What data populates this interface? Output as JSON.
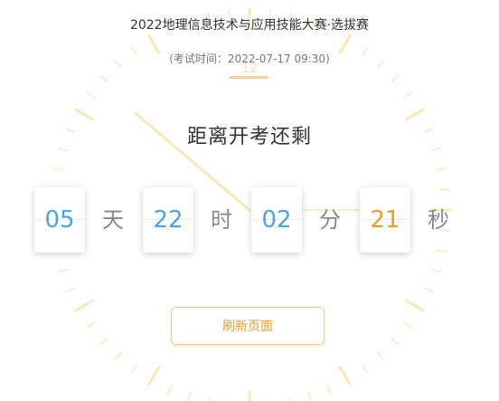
{
  "header": {
    "title": "2022地理信息技术与应用技能大赛·选拔赛",
    "exam_time": "(考试时间：2022-07-17 09:30)"
  },
  "countdown": {
    "heading": "距离开考还剩",
    "days": "05",
    "days_unit": "天",
    "hours": "22",
    "hours_unit": "时",
    "minutes": "02",
    "minutes_unit": "分",
    "seconds": "21",
    "seconds_unit": "秒"
  },
  "actions": {
    "refresh_label": "刷新页面"
  },
  "colors": {
    "accent_orange": "#ef9a2c",
    "digit_blue": "#4da3e8",
    "clock_faint": "#fbe3a6"
  },
  "background": {
    "clock_face_label": "12"
  }
}
